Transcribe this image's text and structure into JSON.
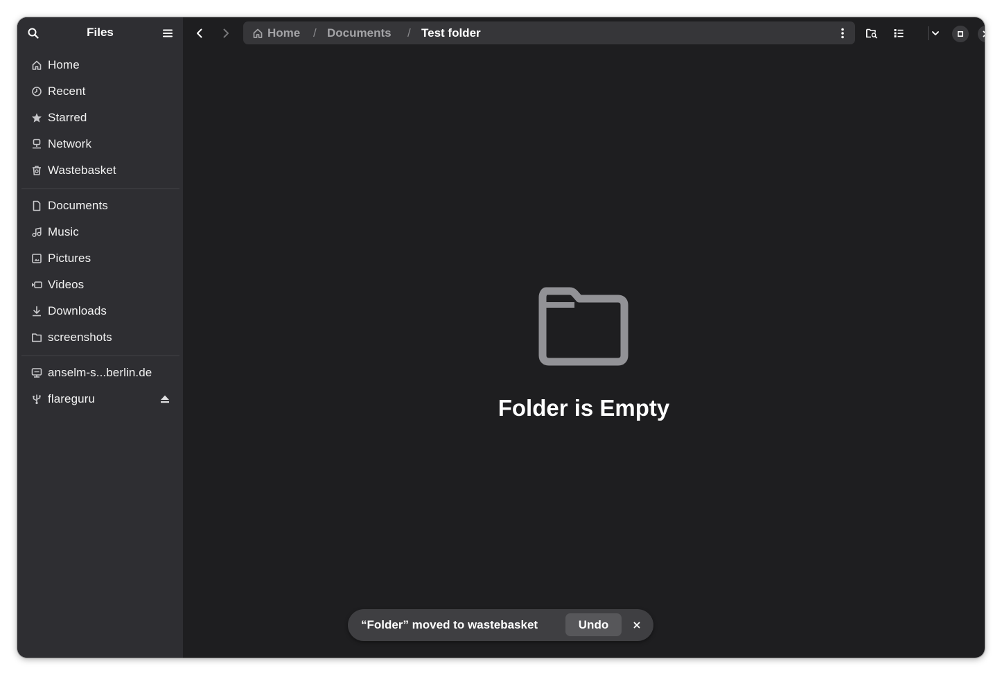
{
  "app": {
    "title": "Files"
  },
  "sidebar": {
    "places": [
      {
        "label": "Home",
        "icon": "home-icon"
      },
      {
        "label": "Recent",
        "icon": "clock-icon"
      },
      {
        "label": "Starred",
        "icon": "star-icon"
      },
      {
        "label": "Network",
        "icon": "network-icon"
      },
      {
        "label": "Wastebasket",
        "icon": "trash-icon"
      }
    ],
    "bookmarks": [
      {
        "label": "Documents",
        "icon": "document-icon"
      },
      {
        "label": "Music",
        "icon": "music-icon"
      },
      {
        "label": "Pictures",
        "icon": "picture-icon"
      },
      {
        "label": "Videos",
        "icon": "video-icon"
      },
      {
        "label": "Downloads",
        "icon": "download-icon"
      },
      {
        "label": "screenshots",
        "icon": "folder-icon"
      }
    ],
    "devices": [
      {
        "label": "anselm-s...berlin.de",
        "icon": "server-icon"
      },
      {
        "label": "flareguru",
        "icon": "usb-icon",
        "ejectable": true
      }
    ]
  },
  "pathbar": {
    "crumbs": [
      "Home",
      "Documents",
      "Test folder"
    ],
    "separator": "/"
  },
  "empty_state": {
    "title": "Folder is Empty",
    "icon": "folder-icon"
  },
  "toast": {
    "message": "“Folder” moved to wastebasket",
    "action_label": "Undo",
    "close_symbol": "×"
  },
  "colors": {
    "window_bg": "#1e1e20",
    "sidebar_bg": "#2e2e32",
    "pathbar_bg": "#363639",
    "toast_bg": "#3f3f42",
    "icon_gray": "#a3a3a6"
  }
}
